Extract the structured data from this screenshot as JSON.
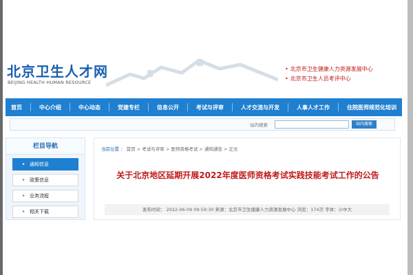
{
  "header": {
    "logo_cn": "北京卫生人才网",
    "logo_en": "BEIJING HEALTH HUMAN RESOURCE",
    "links": [
      "北京市卫生健康人力资源发展中心",
      "北京市卫生人员考评中心"
    ]
  },
  "nav": [
    "首页",
    "中心介绍",
    "中心动态",
    "党建专栏",
    "信息公开",
    "考试与评审",
    "人才交流与开发",
    "人事人才工作",
    "住院医师规范化培训"
  ],
  "search": {
    "label": "站内搜索",
    "placeholder": "",
    "button": "站内搜索"
  },
  "sidebar": {
    "title": "栏目导航",
    "items": [
      "通知信息",
      "政策信息",
      "业务流程",
      "相关下载"
    ]
  },
  "article": {
    "breadcrumb": [
      "当前位置",
      "首页",
      "考试与评审",
      "医师资格考试",
      "通知通告",
      "正文"
    ],
    "title": "关于北京地区延期开展2022年度医师资格考试实践技能考试工作的公告",
    "meta": "发布时间： 2022-06-09 09:59:30 来源：北京市卫生健康人力资源发展中心 浏览：174次 字体：小中大"
  },
  "colors": {
    "nav_blue": "#1f7fd0",
    "title_red": "#c01a1a",
    "brand_blue": "#1a5fb0"
  }
}
